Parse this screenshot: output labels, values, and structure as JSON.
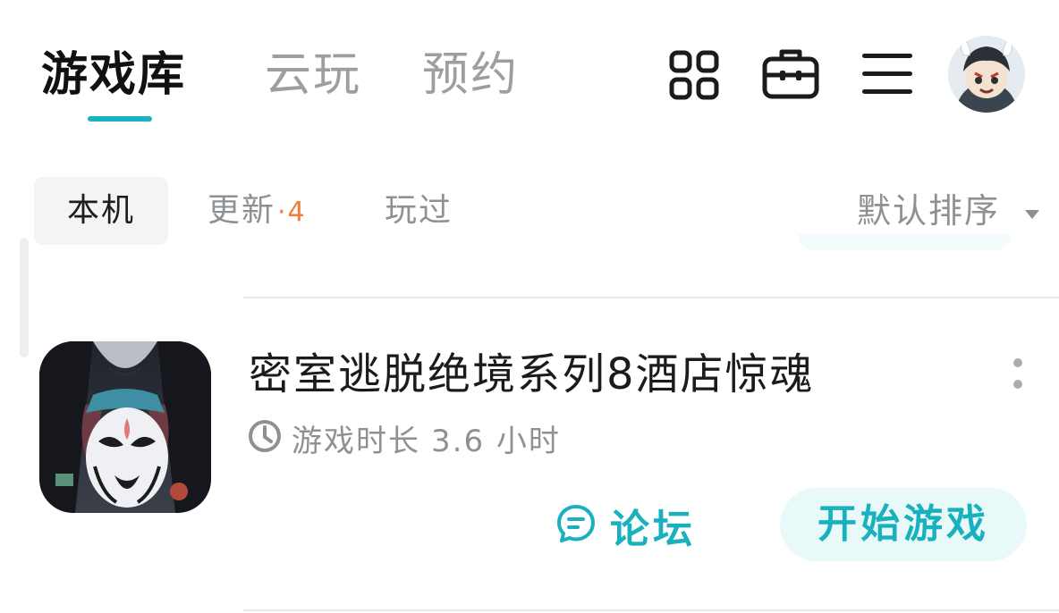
{
  "top_tabs": [
    {
      "label": "游戏库",
      "active": true
    },
    {
      "label": "云玩",
      "active": false
    },
    {
      "label": "预约",
      "active": false
    }
  ],
  "toolbar_icons": [
    "grid-icon",
    "toolbox-icon",
    "menu-icon"
  ],
  "filter_tabs": {
    "local": "本机",
    "updates": "更新",
    "updates_badge": "·4",
    "played": "玩过"
  },
  "sort": {
    "label": "默认排序"
  },
  "game": {
    "title": "密室逃脱绝境系列8酒店惊魂",
    "playtime_label": "游戏时长",
    "playtime_value": "3.6 小时",
    "forum_label": "论坛",
    "play_label": "开始游戏"
  },
  "colors": {
    "accent": "#1ab3c1",
    "badge": "#f17b3a",
    "muted_text": "#8e9194",
    "play_button_bg": "#e9f9fa"
  }
}
